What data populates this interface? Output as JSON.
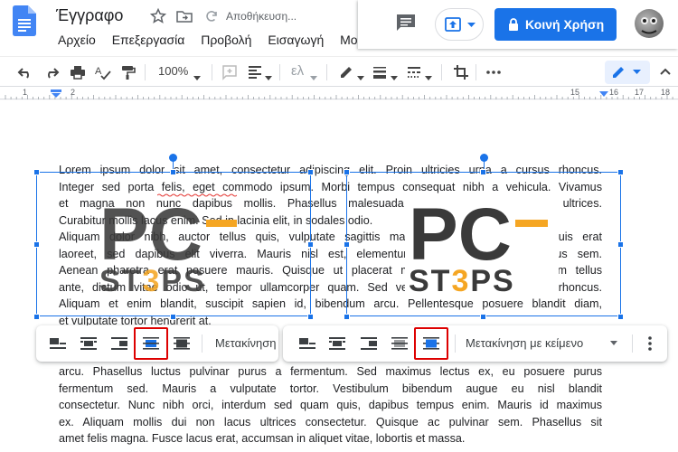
{
  "header": {
    "doc_title": "Έγγραφο",
    "save_status": "Αποθήκευση...",
    "share_label": "Κοινή Χρήση",
    "menu": [
      "Αρχείο",
      "Επεξεργασία",
      "Προβολή",
      "Εισαγωγή",
      "Μο"
    ]
  },
  "toolbar": {
    "zoom": "100%",
    "style_label": "ελ"
  },
  "ruler": {
    "numbers": [
      "1",
      "2",
      "15",
      "16",
      "17",
      "18"
    ]
  },
  "body_lines_top": [
    "Lorem ipsum dolor sit amet, consectetur adipiscing elit. Proin ultricies urna a cursus rhoncus.",
    "Integer sed porta felis, eget commodo ipsum. Morbi tempus consequat nibh a vehicula. Vivamus",
    "et magna non nunc dapibus mollis. Phasellus malesuada mi eu nibh malesuada ultrices.",
    "Curabitur mollis lacus enim. Sed in lacinia elit, in sodales odio.",
    "Aliquam dolor nibh, auctor tellus quis, vulputate sagittis massa. Cras lacinia neque quis erat",
    "laoreet, sed dapibus elit viverra. Mauris nisl est, elementum id elit in, auctor tempus sem.",
    "Aenean pharetra erat posuere mauris. Quisque ut placerat mauris. Donec eget dignissim tellus",
    "ante, dictum vitae odio ut, tempor ullamcorper quam. Sed vestibulum sit amet eros in rhoncus.",
    "Aliquam et enim blandit, suscipit sapien id, bibendum arcu. Pellentesque posuere blandit diam,",
    "et vulputate tortor hendrerit at."
  ],
  "body_lines_bottom": [
    "arcu. Phasellus luctus pulvinar purus a fermentum. Sed maximus lectus ex, eu posuere purus",
    "fermentum sed. Mauris a vulputate tortor. Vestibulum bibendum augue eu nisl blandit",
    "consectetur. Nunc nibh orci, interdum sed quam quis, dapibus tempus enim. Mauris id maximus",
    "ex. Aliquam mollis dui non lacus ultrices consectetur. Quisque ac pulvinar sem. Phasellus sit",
    "amet felis magna. Fusce lacus erat, accumsan in aliquet vitae, lobortis et massa."
  ],
  "logo": {
    "line1": "PC",
    "line2_a": "ST",
    "line2_b": "3",
    "line2_c": "PS"
  },
  "image_toolbar_left": {
    "move_label": "Μετακίνηση"
  },
  "image_toolbar_right": {
    "move_label": "Μετακίνηση με κείμενο"
  },
  "colors": {
    "accent": "#1a73e8",
    "highlight": "#dd0000",
    "logo_dark": "#3a3a3a",
    "logo_orange": "#f5a623"
  }
}
